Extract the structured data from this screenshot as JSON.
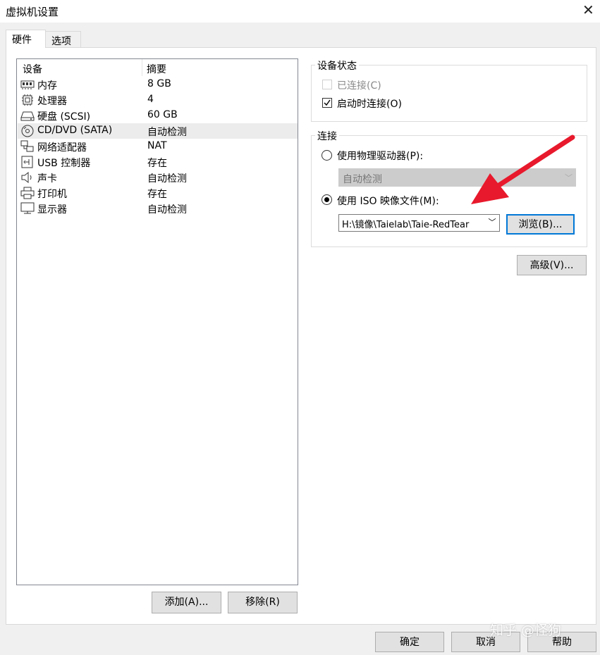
{
  "window": {
    "title": "虚拟机设置"
  },
  "tabs": [
    {
      "label": "硬件"
    },
    {
      "label": "选项"
    }
  ],
  "device_list": {
    "headers": {
      "device": "设备",
      "summary": "摘要"
    },
    "rows": [
      {
        "name": "内存",
        "summary": "8 GB",
        "icon": "memory-icon"
      },
      {
        "name": "处理器",
        "summary": "4",
        "icon": "cpu-icon"
      },
      {
        "name": "硬盘 (SCSI)",
        "summary": "60 GB",
        "icon": "harddisk-icon"
      },
      {
        "name": "CD/DVD (SATA)",
        "summary": "自动检测",
        "icon": "cd-dvd-icon",
        "selected": true
      },
      {
        "name": "网络适配器",
        "summary": "NAT",
        "icon": "network-adapter-icon"
      },
      {
        "name": "USB 控制器",
        "summary": "存在",
        "icon": "usb-icon"
      },
      {
        "name": "声卡",
        "summary": "自动检测",
        "icon": "speaker-icon"
      },
      {
        "name": "打印机",
        "summary": "存在",
        "icon": "printer-icon"
      },
      {
        "name": "显示器",
        "summary": "自动检测",
        "icon": "monitor-icon"
      }
    ]
  },
  "list_buttons": {
    "add": "添加(A)...",
    "remove": "移除(R)"
  },
  "device_status": {
    "title": "设备状态",
    "connected": {
      "label": "已连接(C)",
      "checked": false,
      "disabled": true
    },
    "connect_at_power_on": {
      "label": "启动时连接(O)",
      "checked": true
    }
  },
  "connection": {
    "title": "连接",
    "physical": {
      "label": "使用物理驱动器(P):",
      "selected": false
    },
    "physical_select": {
      "value": "自动检测"
    },
    "iso": {
      "label": "使用 ISO 映像文件(M):",
      "selected": true
    },
    "iso_path": {
      "value": "H:\\镜像\\Taielab\\Taie-RedTear"
    },
    "browse": "浏览(B)..."
  },
  "advanced": "高级(V)...",
  "footer": {
    "ok": "确定",
    "cancel": "取消",
    "help": "帮助"
  },
  "watermark": "知乎 @怪狗",
  "colors": {
    "arrow": "#e8192c",
    "accent": "#0078d7",
    "selection": "#ececec"
  }
}
